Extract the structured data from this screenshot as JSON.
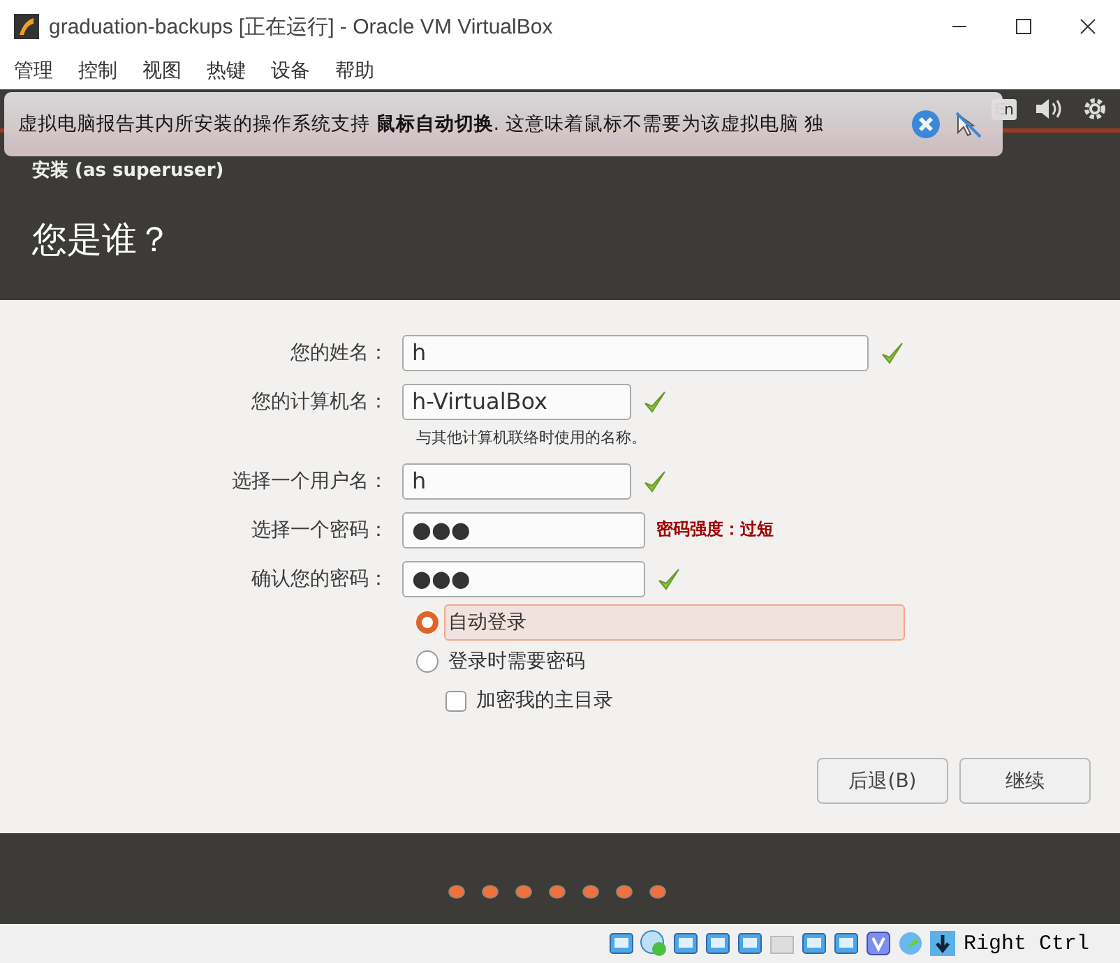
{
  "window": {
    "title": "graduation-backups [正在运行] - Oracle VM VirtualBox"
  },
  "menu": [
    "管理",
    "控制",
    "视图",
    "热键",
    "设备",
    "帮助"
  ],
  "notification": {
    "message": "虚拟电脑报告其内所安装的操作系统支持 **鼠标自动切换**.  这意味着鼠标不需要为该虚拟电脑  独"
  },
  "vm_panel": {
    "keyboard_layout": "En"
  },
  "installer": {
    "heading": "安装 (as superuser)",
    "title": "您是谁？",
    "fields": [
      {
        "label": "您的姓名：",
        "value": "h",
        "valid": true
      },
      {
        "label": "您的计算机名：",
        "value": "h-VirtualBox",
        "valid": true,
        "hint": "与其他计算机联络时使用的名称。"
      },
      {
        "label": "选择一个用户名：",
        "value": "h",
        "valid": true
      },
      {
        "label": "选择一个密码：",
        "value": "●●●",
        "valid": false,
        "note": "密码强度：过短"
      },
      {
        "label": "确认您的密码：",
        "value": "●●●",
        "valid": true
      }
    ],
    "login_options": [
      {
        "label": "自动登录",
        "selected": true
      },
      {
        "label": "登录时需要密码",
        "selected": false
      }
    ],
    "encrypt_home": {
      "label": "加密我的主目录",
      "checked": false
    },
    "buttons": [
      "后退(B)",
      "继续"
    ]
  },
  "status_bar": {
    "host_key": "Right Ctrl"
  }
}
